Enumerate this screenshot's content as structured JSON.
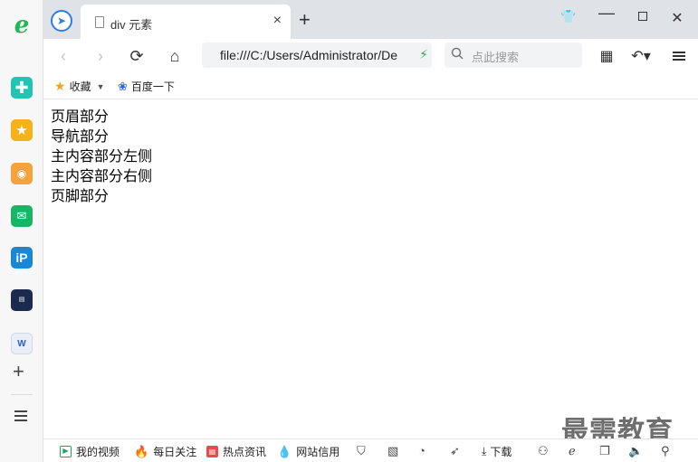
{
  "tab": {
    "title": "div 元素",
    "close": "×",
    "new_tab": "+"
  },
  "window": {
    "minimize": "—",
    "close": "✕"
  },
  "toolbar": {
    "back": "‹",
    "forward": "›",
    "reload": "⟳",
    "home": "⌂",
    "address": "file:///C:/Users/Administrator/De",
    "search_placeholder": "点此搜索",
    "grid": "▦",
    "undo": "↶▾"
  },
  "bookmarks": {
    "favorites": "收藏",
    "baidu": "百度一下"
  },
  "page": {
    "lines": [
      "页眉部分",
      "导航部分",
      "主内容部分左侧",
      "主内容部分右侧",
      "页脚部分"
    ]
  },
  "watermark": "最需教育",
  "statusbar": {
    "my_video": "我的视频",
    "daily_focus": "每日关注",
    "hot_news": "热点资讯",
    "site_credit": "网站信用",
    "download": "下载"
  },
  "icons": {
    "sidebar": [
      "browser-logo-icon",
      "add-app-icon",
      "favorites-star-icon",
      "weibo-icon",
      "mail-icon",
      "ip-app-icon",
      "news-app-icon",
      "word-doc-icon",
      "add-icon",
      "list-icon"
    ],
    "statusbar": [
      "shield-icon",
      "image-icon",
      "speed-icon",
      "rocket-icon",
      "download-icon",
      "glasses-icon",
      "ie-icon",
      "window-icon",
      "sound-icon",
      "zoom-icon"
    ]
  },
  "colors": {
    "accent": "#2f7de1",
    "tabbar_bg": "#dfe3e8",
    "secure_green": "#22b85c"
  }
}
